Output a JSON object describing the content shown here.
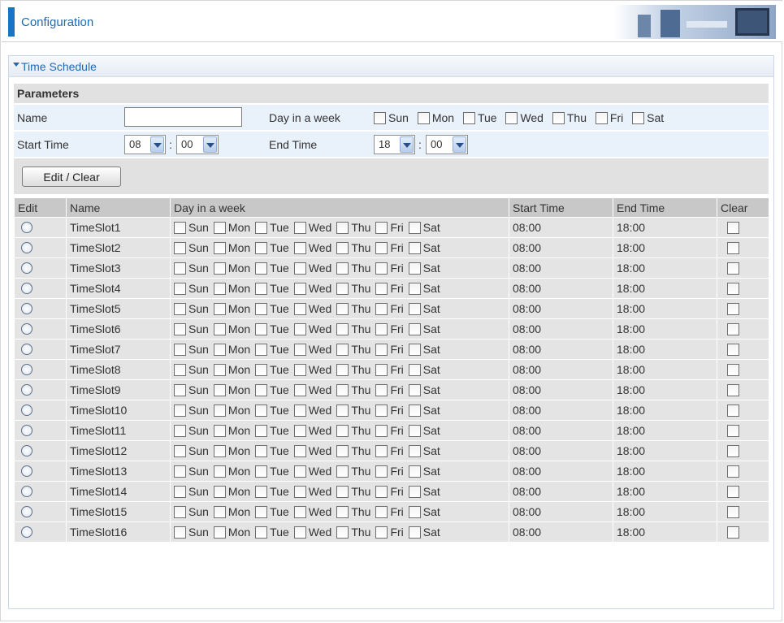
{
  "header": {
    "title": "Configuration"
  },
  "section": {
    "title": "Time Schedule"
  },
  "params": {
    "heading": "Parameters",
    "name_label": "Name",
    "name_value": "",
    "day_label": "Day in a week",
    "days": [
      "Sun",
      "Mon",
      "Tue",
      "Wed",
      "Thu",
      "Fri",
      "Sat"
    ],
    "start_label": "Start Time",
    "start_hour": "08",
    "start_min": "00",
    "end_label": "End Time",
    "end_hour": "18",
    "end_min": "00",
    "colon": ":",
    "edit_button": "Edit / Clear"
  },
  "table": {
    "columns": [
      "Edit",
      "Name",
      "Day in a week",
      "Start Time",
      "End Time",
      "Clear"
    ],
    "rows": [
      {
        "name": "TimeSlot1",
        "start": "08:00",
        "end": "18:00"
      },
      {
        "name": "TimeSlot2",
        "start": "08:00",
        "end": "18:00"
      },
      {
        "name": "TimeSlot3",
        "start": "08:00",
        "end": "18:00"
      },
      {
        "name": "TimeSlot4",
        "start": "08:00",
        "end": "18:00"
      },
      {
        "name": "TimeSlot5",
        "start": "08:00",
        "end": "18:00"
      },
      {
        "name": "TimeSlot6",
        "start": "08:00",
        "end": "18:00"
      },
      {
        "name": "TimeSlot7",
        "start": "08:00",
        "end": "18:00"
      },
      {
        "name": "TimeSlot8",
        "start": "08:00",
        "end": "18:00"
      },
      {
        "name": "TimeSlot9",
        "start": "08:00",
        "end": "18:00"
      },
      {
        "name": "TimeSlot10",
        "start": "08:00",
        "end": "18:00"
      },
      {
        "name": "TimeSlot11",
        "start": "08:00",
        "end": "18:00"
      },
      {
        "name": "TimeSlot12",
        "start": "08:00",
        "end": "18:00"
      },
      {
        "name": "TimeSlot13",
        "start": "08:00",
        "end": "18:00"
      },
      {
        "name": "TimeSlot14",
        "start": "08:00",
        "end": "18:00"
      },
      {
        "name": "TimeSlot15",
        "start": "08:00",
        "end": "18:00"
      },
      {
        "name": "TimeSlot16",
        "start": "08:00",
        "end": "18:00"
      }
    ]
  },
  "colors": {
    "accent": "#1b74c3",
    "row_bg": "#e4e4e4",
    "header_bg": "#c8c8c8",
    "param_row_bg": "#e9f1fb"
  }
}
